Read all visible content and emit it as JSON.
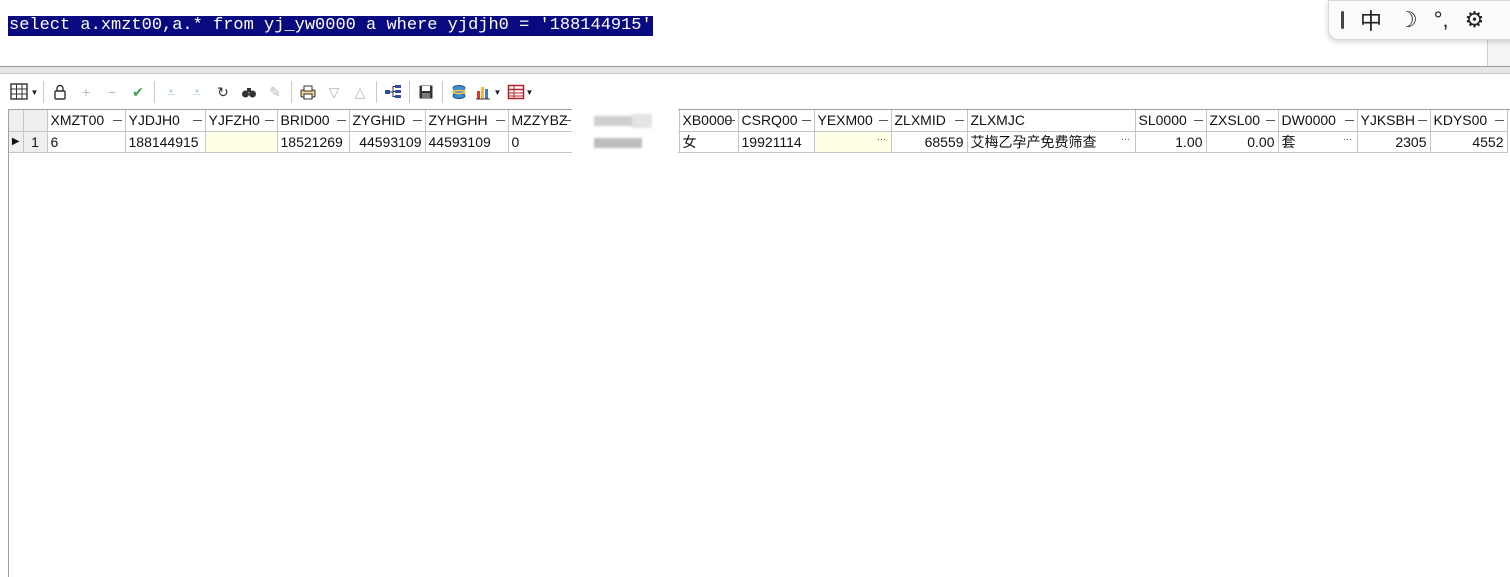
{
  "editor": {
    "sql": "select a.xmzt00,a.* from yj_yw0000 a where yjdjh0 = '188144915'"
  },
  "ime": {
    "mode_char": "中",
    "moon": "☽",
    "punct": "°,",
    "gear": "⚙"
  },
  "toolbar": {
    "icons": [
      "grid-view-icon",
      "lock-icon",
      "add-icon",
      "remove-icon",
      "check-icon",
      "expand-down-icon",
      "collapse-down-icon",
      "refresh-icon",
      "find-icon",
      "eraser-icon",
      "print-icon",
      "sort-desc-icon",
      "sort-asc-icon",
      "tree-icon",
      "save-icon",
      "database-icon",
      "chart-icon",
      "table-icon"
    ]
  },
  "grid": {
    "columns": [
      "XMZT00",
      "YJDJH0",
      "YJFZH0",
      "BRID00",
      "ZYGHID",
      "ZYHGHH",
      "MZZYBZ",
      "",
      "XB0000",
      "CSRQ00",
      "YEXM00",
      "ZLXMID",
      "ZLXMJC",
      "SL0000",
      "ZXSL00",
      "DW0000",
      "YJKSBH",
      "KDYS00"
    ],
    "rows": [
      {
        "row_number": "1",
        "cells": [
          "6",
          "188144915",
          "",
          "18521269",
          "44593109",
          "44593109",
          "0",
          "",
          "女",
          "19921114",
          "",
          "68559",
          "艾梅乙孕产免费筛查",
          "1.00",
          "0.00",
          "套",
          "2305",
          "4552"
        ]
      }
    ]
  }
}
